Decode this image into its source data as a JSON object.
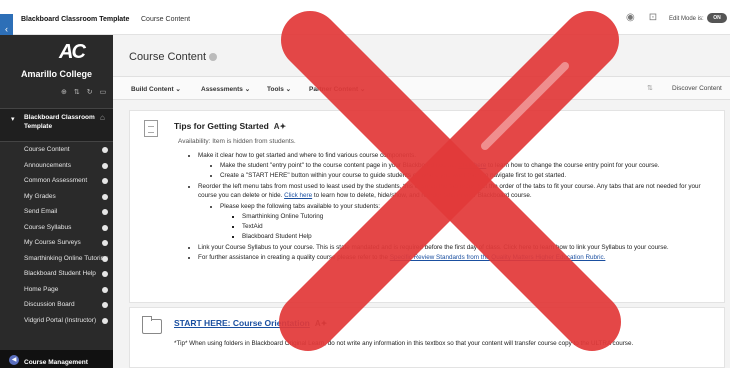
{
  "topbar": {
    "breadcrumb_course": "Blackboard Classroom Template",
    "breadcrumb_page": "Course Content",
    "edit_mode_label": "Edit Mode is:",
    "edit_mode_state": "ON"
  },
  "sidebar": {
    "logo_text": "Amarillo College",
    "course_title": "Blackboard Classroom Template",
    "items": [
      {
        "label": "Course Content"
      },
      {
        "label": "Announcements"
      },
      {
        "label": "Common Assessment"
      },
      {
        "label": "My Grades"
      },
      {
        "label": "Send Email"
      },
      {
        "label": "Course Syllabus"
      },
      {
        "label": "My Course Surveys"
      },
      {
        "label": "Smarthinking Online Tutoring"
      },
      {
        "label": "Blackboard Student Help"
      },
      {
        "label": "Home Page"
      },
      {
        "label": "Discussion Board"
      },
      {
        "label": "Vidgrid Portal (Instructor)"
      }
    ],
    "management_label": "Course Management"
  },
  "main": {
    "title": "Course Content",
    "actions": [
      "Build Content",
      "Assessments",
      "Tools",
      "Partner Content"
    ],
    "discover_label": "Discover Content",
    "item1": {
      "title": "Tips for Getting Started",
      "availability_label": "Availability:",
      "availability_value": "Item is hidden from students.",
      "b1": "Make it clear how to get started and where to find various course components.",
      "b1a_pre": "Make the student \"entry point\" to the course content page in your Blackboard course.",
      "b1a_link": "Click here",
      "b1a_post": "to learn how to change the course entry point for your course.",
      "b1b": "Create a \"START HERE\" button within your course to guide students on where you want them to navigate first to get started.",
      "b2_pre": "Reorder the left menu tabs from most used to least used by the students, this ensures the tab order. Set the order of the tabs to fit your course. Any tabs that are not needed for your course you can delete or hide.",
      "b2_link": "Click here",
      "b2_post": "to learn how to delete, hide/show, and reorder tabs in your Blackboard course.",
      "b2a": "Please keep the following tabs available to your students:",
      "tabs_to_keep": [
        "Smarthinking Online Tutoring",
        "TextAid",
        "Blackboard Student Help"
      ],
      "b3": "Link your Course Syllabus to your course. This is state mandated and is required before the first day of class. Click here to learn how to link your Syllabus to your course.",
      "b4_pre": "For further assistance in creating a quality course please refer to the",
      "b4_link": "Specific Review Standards from the Quality Matters Higher Education Rubric."
    },
    "item2": {
      "title": "START HERE: Course Orientation",
      "text": "*Tip* When using folders in Blackboard Original Learn, do not write any information in this textbox so that your content will transfer course copy to the ULTRA course."
    }
  },
  "overlay": {
    "type": "red-x",
    "color": "#e23a3a"
  }
}
